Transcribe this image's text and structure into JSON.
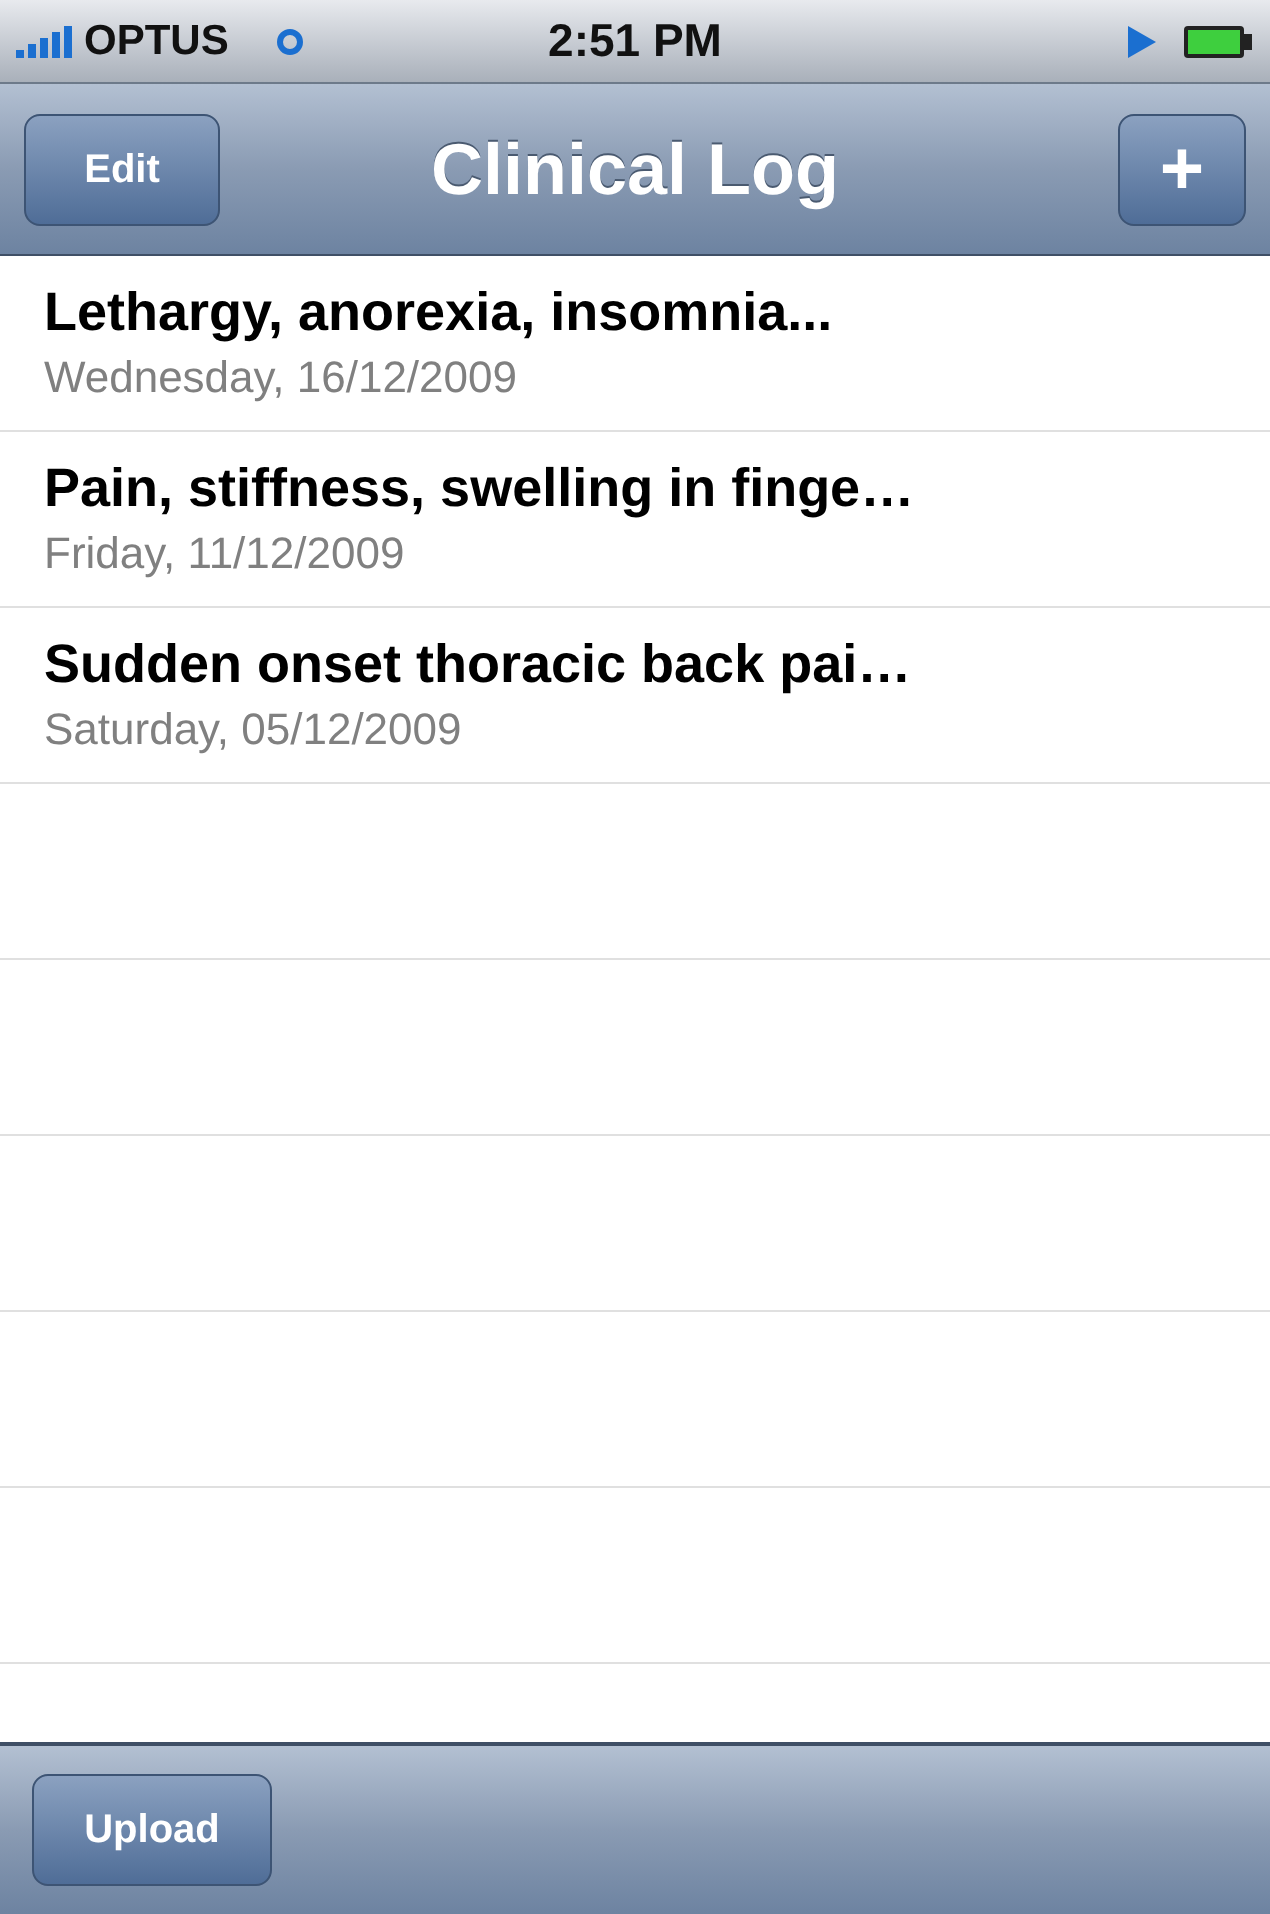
{
  "status_bar": {
    "carrier": "OPTUS",
    "time": "2:51 PM"
  },
  "nav_bar": {
    "left_button": "Edit",
    "title": "Clinical Log",
    "right_button": "+"
  },
  "entries": [
    {
      "title": "Lethargy, anorexia, insomnia...",
      "date": "Wednesday, 16/12/2009"
    },
    {
      "title": "Pain, stiffness, swelling in finge…",
      "date": "Friday, 11/12/2009"
    },
    {
      "title": "Sudden onset thoracic back pai…",
      "date": "Saturday, 05/12/2009"
    }
  ],
  "toolbar": {
    "button": "Upload"
  }
}
